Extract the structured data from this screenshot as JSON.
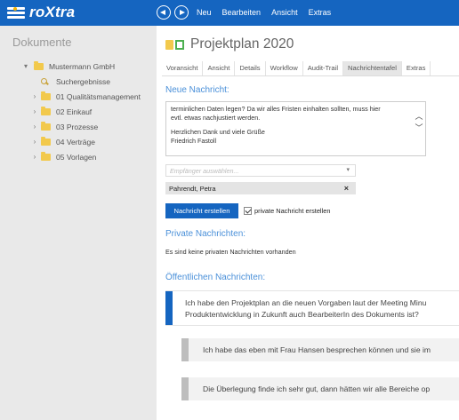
{
  "app": {
    "name": "roXtra"
  },
  "topbar": {
    "menu": [
      "Neu",
      "Bearbeiten",
      "Ansicht",
      "Extras"
    ]
  },
  "sidebar": {
    "title": "Dokumente",
    "root": "Mustermann GmbH",
    "search_results": "Suchergebnisse",
    "items": [
      {
        "label": "01 Qualitätsmanagement"
      },
      {
        "label": "02 Einkauf"
      },
      {
        "label": "03 Prozesse"
      },
      {
        "label": "04 Verträge"
      },
      {
        "label": "05 Vorlagen"
      }
    ]
  },
  "main": {
    "title": "Projektplan 2020",
    "tabs": [
      "Voransicht",
      "Ansicht",
      "Details",
      "Workflow",
      "Audit-Trail",
      "Nachrichtentafel",
      "Extras"
    ],
    "active_tab": "Nachrichtentafel",
    "new_message": {
      "heading": "Neue Nachricht:",
      "lines": [
        "terminlichen Daten legen? Da wir alles Fristen einhalten sollten, muss hier",
        "evtl. etwas nachjustiert werden.",
        "",
        "Herzlichen Dank und viele Grüße",
        "Friedrich Fastoll"
      ],
      "recipient_placeholder": "Empfänger auswählen...",
      "selected_recipient": "Pahrendt, Petra",
      "create_button": "Nachricht erstellen",
      "private_checkbox_label": "private Nachricht erstellen",
      "private_checked": true
    },
    "private_messages": {
      "heading": "Private Nachrichten:",
      "empty_text": "Es sind keine privaten Nachrichten vorhanden"
    },
    "public_messages": {
      "heading": "Öffentlichen Nachrichten:",
      "items": [
        {
          "lines": [
            "Ich habe den Projektplan an die neuen Vorgaben laut der Meeting Minu",
            "Produktentwicklung in Zukunft auch BearbeiterIn des Dokuments ist?"
          ]
        }
      ],
      "replies": [
        {
          "text": "Ich habe das eben mit Frau Hansen besprechen können und sie im"
        },
        {
          "text": "Die Überlegung finde ich sehr gut, dann hätten wir alle Bereiche op"
        }
      ]
    }
  },
  "colors": {
    "brand": "#1565c0",
    "heading": "#4a90d9",
    "sidebar_bg": "#e9e9e9",
    "reply_bar": "#bdbdbd"
  }
}
